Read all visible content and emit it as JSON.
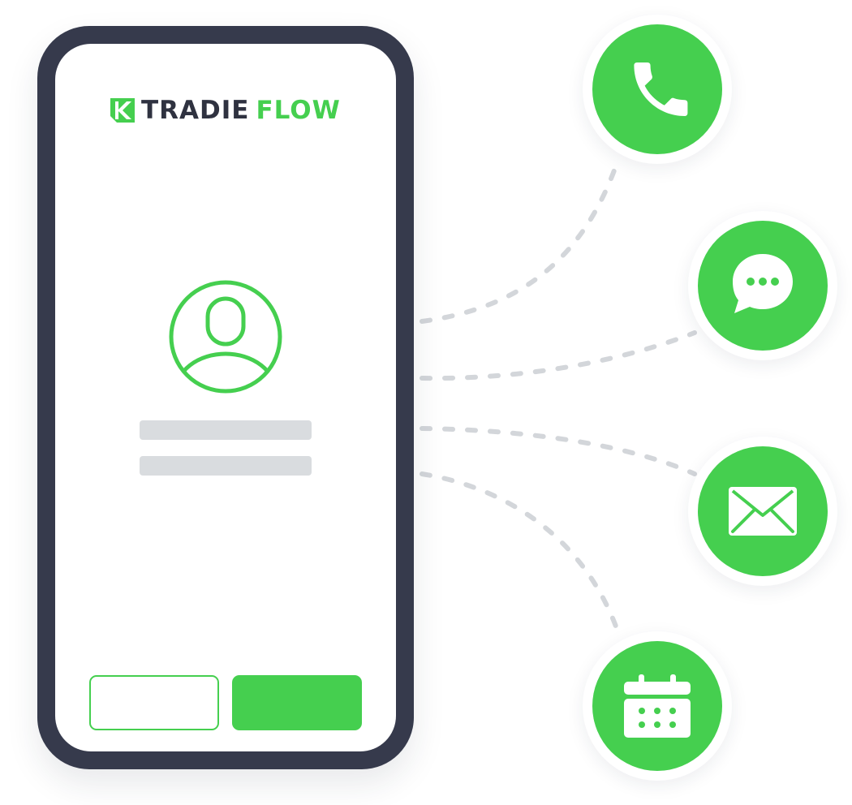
{
  "brand": {
    "name_part1": "TRADIE",
    "name_part2": "FLOW",
    "primary_color": "#45cf4f",
    "dark_color": "#2f3240",
    "phone_frame_color": "#363a4c",
    "placeholder_color": "#d9dcdf",
    "connector_color": "#d3d6da"
  },
  "screen": {
    "avatar_icon": "user-circle-icon",
    "placeholder_lines": 2,
    "buttons": [
      {
        "style": "outline",
        "label": ""
      },
      {
        "style": "solid",
        "label": ""
      }
    ]
  },
  "channels": [
    {
      "id": "phone",
      "icon": "phone-icon"
    },
    {
      "id": "chat",
      "icon": "chat-bubble-icon"
    },
    {
      "id": "email",
      "icon": "envelope-icon"
    },
    {
      "id": "calendar",
      "icon": "calendar-icon"
    }
  ]
}
